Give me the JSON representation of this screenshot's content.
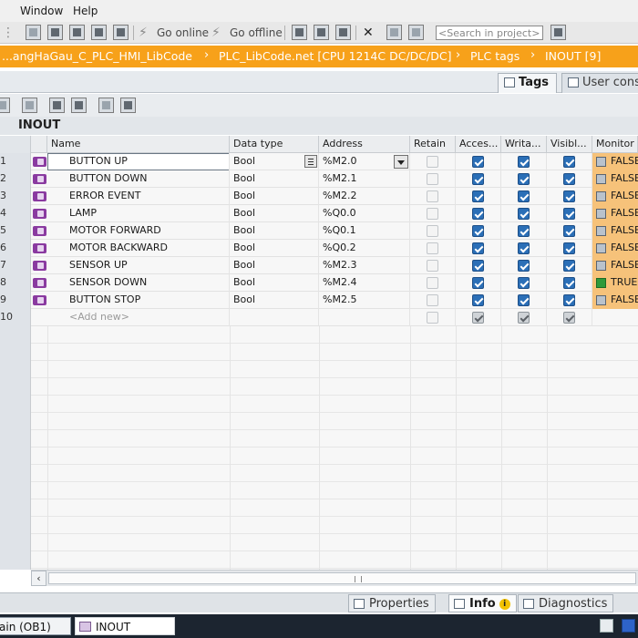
{
  "menu": {
    "window": "Window",
    "help": "Help"
  },
  "toolbar": {
    "go_online": "Go online",
    "go_offline": "Go offline",
    "search_placeholder": "<Search in project>"
  },
  "breadcrumb": [
    "...angHaGau_C_PLC_HMI_LibCode",
    "PLC_LibCode.net [CPU 1214C DC/DC/DC]",
    "PLC tags",
    "INOUT [9]"
  ],
  "tabs": {
    "tags": "Tags",
    "user_constants": "User cons"
  },
  "section_title": "INOUT",
  "table": {
    "headers": {
      "name": "Name",
      "data_type": "Data type",
      "address": "Address",
      "retain": "Retain",
      "accessible": "Acces...",
      "writable": "Writa...",
      "visible": "Visibl...",
      "monitor": "Monitor v"
    },
    "rows": [
      {
        "num": "1",
        "name": "BUTTON UP",
        "type": "Bool",
        "address": "%M2.0",
        "retain": false,
        "accessible": true,
        "writable": true,
        "visible": true,
        "monitor": "FALSE"
      },
      {
        "num": "2",
        "name": "BUTTON DOWN",
        "type": "Bool",
        "address": "%M2.1",
        "retain": false,
        "accessible": true,
        "writable": true,
        "visible": true,
        "monitor": "FALSE"
      },
      {
        "num": "3",
        "name": "ERROR EVENT",
        "type": "Bool",
        "address": "%M2.2",
        "retain": false,
        "accessible": true,
        "writable": true,
        "visible": true,
        "monitor": "FALSE"
      },
      {
        "num": "4",
        "name": "LAMP",
        "type": "Bool",
        "address": "%Q0.0",
        "retain": false,
        "accessible": true,
        "writable": true,
        "visible": true,
        "monitor": "FALSE"
      },
      {
        "num": "5",
        "name": "MOTOR FORWARD",
        "type": "Bool",
        "address": "%Q0.1",
        "retain": false,
        "accessible": true,
        "writable": true,
        "visible": true,
        "monitor": "FALSE"
      },
      {
        "num": "6",
        "name": "MOTOR BACKWARD",
        "type": "Bool",
        "address": "%Q0.2",
        "retain": false,
        "accessible": true,
        "writable": true,
        "visible": true,
        "monitor": "FALSE"
      },
      {
        "num": "7",
        "name": "SENSOR UP",
        "type": "Bool",
        "address": "%M2.3",
        "retain": false,
        "accessible": true,
        "writable": true,
        "visible": true,
        "monitor": "FALSE"
      },
      {
        "num": "8",
        "name": "SENSOR DOWN",
        "type": "Bool",
        "address": "%M2.4",
        "retain": false,
        "accessible": true,
        "writable": true,
        "visible": true,
        "monitor": "TRUE"
      },
      {
        "num": "9",
        "name": "BUTTON STOP",
        "type": "Bool",
        "address": "%M2.5",
        "retain": false,
        "accessible": true,
        "writable": true,
        "visible": true,
        "monitor": "FALSE"
      }
    ],
    "add_row": {
      "num": "10",
      "label": "<Add new>"
    }
  },
  "bottom_tabs": {
    "properties": "Properties",
    "info": "Info",
    "info_badge": "i",
    "diagnostics": "Diagnostics"
  },
  "taskbar": {
    "main": "ain (OB1)",
    "inout": "INOUT"
  },
  "colors": {
    "accent": "#f7a11a",
    "monitor_bg": "#f6c27a",
    "checkbox": "#2b6fb7"
  }
}
